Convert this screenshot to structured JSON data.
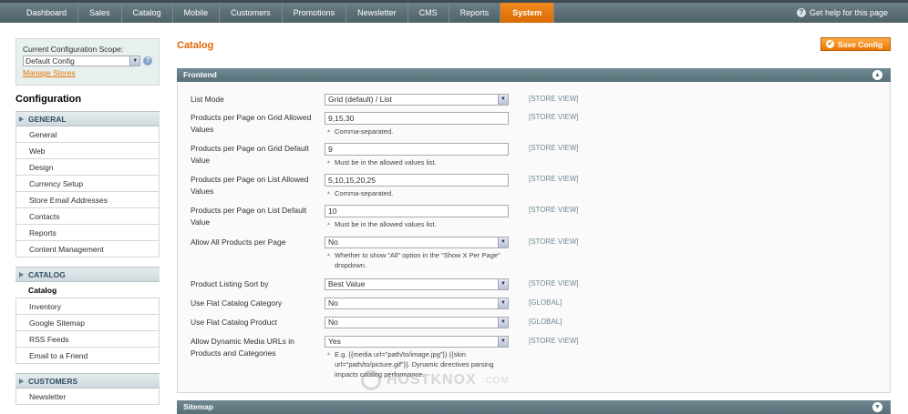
{
  "nav": {
    "items": [
      "Dashboard",
      "Sales",
      "Catalog",
      "Mobile",
      "Customers",
      "Promotions",
      "Newsletter",
      "CMS",
      "Reports",
      "System"
    ],
    "active": "System",
    "help": "Get help for this page"
  },
  "scope": {
    "label": "Current Configuration Scope:",
    "value": "Default Config",
    "manage_link": "Manage Stores"
  },
  "sidebar": {
    "title": "Configuration",
    "groups": [
      {
        "heading": "GENERAL",
        "items": [
          "General",
          "Web",
          "Design",
          "Currency Setup",
          "Store Email Addresses",
          "Contacts",
          "Reports",
          "Content Management"
        ]
      },
      {
        "heading": "CATALOG",
        "items": [
          "Catalog",
          "Inventory",
          "Google Sitemap",
          "RSS Feeds",
          "Email to a Friend"
        ]
      },
      {
        "heading": "CUSTOMERS",
        "items": [
          "Newsletter"
        ]
      }
    ],
    "active_item": "Catalog"
  },
  "main": {
    "title": "Catalog",
    "save_label": "Save Config",
    "section": "Frontend",
    "fields": [
      {
        "label": "List Mode",
        "type": "select",
        "value": "Grid (default) / List",
        "scope": "[STORE VIEW]"
      },
      {
        "label": "Products per Page on Grid Allowed Values",
        "type": "input",
        "value": "9,15,30",
        "note": "Comma-separated.",
        "scope": "[STORE VIEW]"
      },
      {
        "label": "Products per Page on Grid Default Value",
        "type": "input",
        "value": "9",
        "note": "Must be in the allowed values list.",
        "scope": "[STORE VIEW]"
      },
      {
        "label": "Products per Page on List Allowed Values",
        "type": "input",
        "value": "5,10,15,20,25",
        "note": "Comma-separated.",
        "scope": "[STORE VIEW]"
      },
      {
        "label": "Products per Page on List Default Value",
        "type": "input",
        "value": "10",
        "note": "Must be in the allowed values list.",
        "scope": "[STORE VIEW]"
      },
      {
        "label": "Allow All Products per Page",
        "type": "select",
        "value": "No",
        "note": "Whether to show \"All\" option in the \"Show X Per Page\" dropdown.",
        "scope": "[STORE VIEW]"
      },
      {
        "label": "Product Listing Sort by",
        "type": "select",
        "value": "Best Value",
        "scope": "[STORE VIEW]"
      },
      {
        "label": "Use Flat Catalog Category",
        "type": "select",
        "value": "No",
        "scope": "[GLOBAL]"
      },
      {
        "label": "Use Flat Catalog Product",
        "type": "select",
        "value": "No",
        "scope": "[GLOBAL]"
      },
      {
        "label": "Allow Dynamic Media URLs in Products and Categories",
        "type": "select",
        "value": "Yes",
        "note": "E.g. {{media url=\"path/to/image.jpg\"}} {{skin url=\"path/to/picture.gif\"}}. Dynamic directives parsing impacts catalog performance.",
        "scope": "[STORE VIEW]"
      }
    ],
    "next_section": "Sitemap"
  },
  "watermark": {
    "text": "HOSTKNOX",
    "suffix": ".COM"
  }
}
